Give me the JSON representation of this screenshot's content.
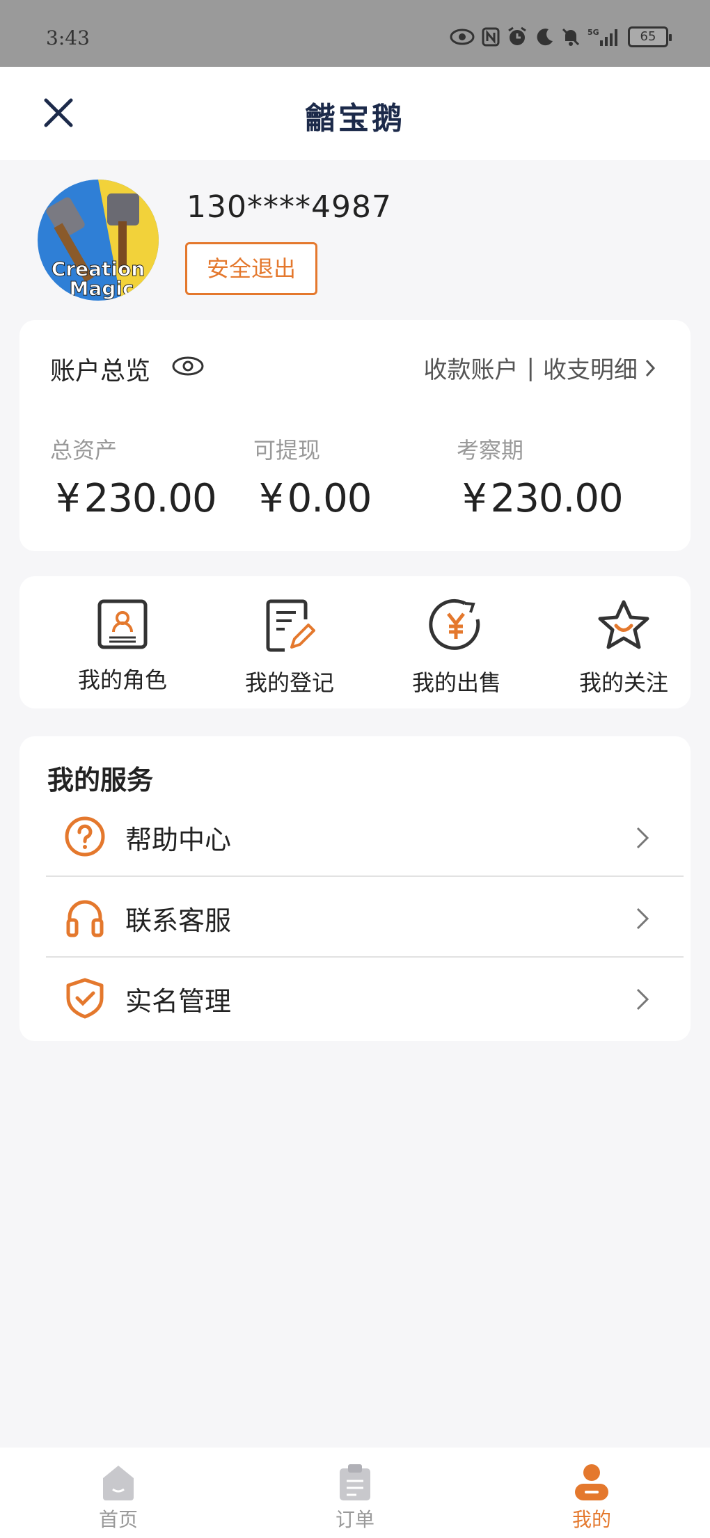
{
  "status_bar": {
    "time": "3:43",
    "battery": "65",
    "network": "5G"
  },
  "header": {
    "title": "龤宝鹅"
  },
  "profile": {
    "phone": "130****4987",
    "logout_label": "安全退出",
    "avatar_text": "Creation Magic"
  },
  "account": {
    "title": "账户总览",
    "link_accounts": "收款账户",
    "separator": "|",
    "link_details": "收支明细",
    "stats": [
      {
        "label": "总资产",
        "currency": "¥",
        "amount": "230.00"
      },
      {
        "label": "可提现",
        "currency": "¥",
        "amount": "0.00"
      },
      {
        "label": "考察期",
        "currency": "¥",
        "amount": "230.00"
      }
    ]
  },
  "menu": [
    {
      "label": "我的角色",
      "icon": "role-card-icon"
    },
    {
      "label": "我的登记",
      "icon": "edit-document-icon"
    },
    {
      "label": "我的出售",
      "icon": "yen-cycle-icon"
    },
    {
      "label": "我的关注",
      "icon": "star-smile-icon"
    }
  ],
  "services": {
    "title": "我的服务",
    "items": [
      {
        "label": "帮助中心",
        "icon": "help-icon"
      },
      {
        "label": "联系客服",
        "icon": "headset-icon"
      },
      {
        "label": "实名管理",
        "icon": "shield-check-icon"
      }
    ]
  },
  "tabs": [
    {
      "label": "首页",
      "icon": "home-icon",
      "active": false
    },
    {
      "label": "订单",
      "icon": "clipboard-icon",
      "active": false
    },
    {
      "label": "我的",
      "icon": "user-icon",
      "active": true
    }
  ],
  "colors": {
    "accent": "#e4782d",
    "title_dark": "#1c2a4a",
    "background": "#f6f6f8"
  }
}
